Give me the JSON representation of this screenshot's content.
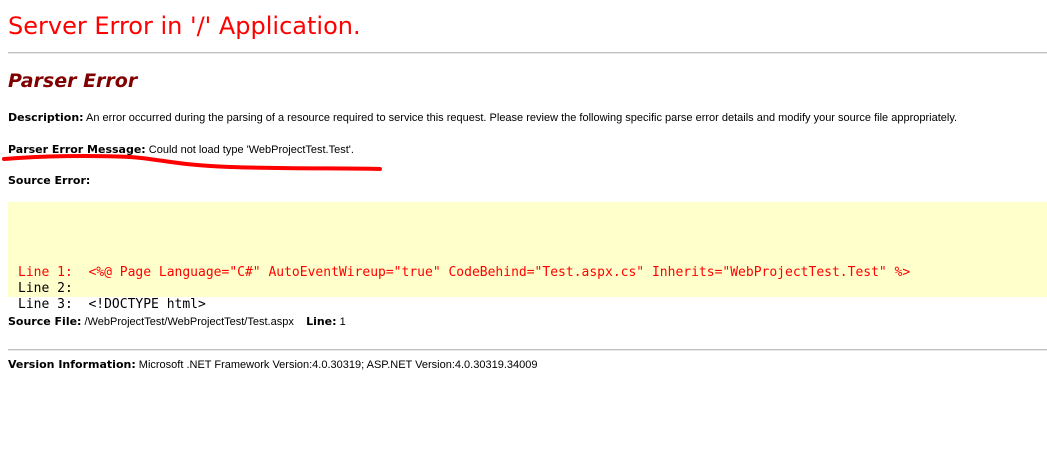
{
  "header": {
    "title": "Server Error in '/' Application.",
    "subtitle": "Parser Error"
  },
  "description": {
    "label": "Description:",
    "text": " An error occurred during the parsing of a resource required to service this request. Please review the following specific parse error details and modify your source file appropriately."
  },
  "parser_message": {
    "label": "Parser Error Message:",
    "text": " Could not load type 'WebProjectTest.Test'."
  },
  "source_error": {
    "label": "Source Error:",
    "lines": [
      {
        "text": "Line 1:  <%@ Page Language=\"C#\" AutoEventWireup=\"true\" CodeBehind=\"Test.aspx.cs\" Inherits=\"WebProjectTest.Test\" %>",
        "highlighted": true
      },
      {
        "text": "Line 2:",
        "highlighted": false
      },
      {
        "text": "Line 3:  <!DOCTYPE html>",
        "highlighted": false
      }
    ]
  },
  "source_file": {
    "label": "Source File:",
    "path": " /WebProjectTest/WebProjectTest/Test.aspx",
    "line_label": "Line:",
    "line_value": " 1"
  },
  "version": {
    "label": "Version Information:",
    "text": " Microsoft .NET Framework Version:4.0.30319; ASP.NET Version:4.0.30319.34009"
  },
  "colors": {
    "title": "#ff0000",
    "subtitle": "#800000",
    "code_background": "#ffffcc",
    "annotation": "#ff0000"
  }
}
